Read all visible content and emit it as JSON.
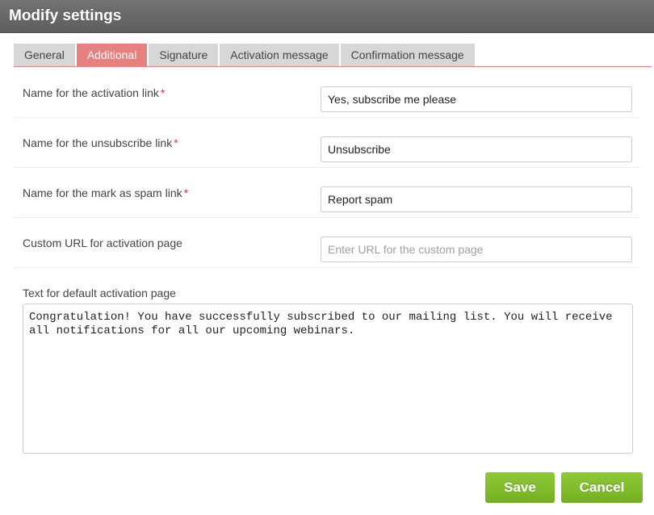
{
  "window": {
    "title": "Modify settings"
  },
  "tabs": [
    {
      "label": "General",
      "active": false
    },
    {
      "label": "Additional",
      "active": true
    },
    {
      "label": "Signature",
      "active": false
    },
    {
      "label": "Activation message",
      "active": false
    },
    {
      "label": "Confirmation message",
      "active": false
    }
  ],
  "form": {
    "activation_link": {
      "label": "Name for the activation link",
      "required_mark": "*",
      "value": "Yes, subscribe me please"
    },
    "unsubscribe_link": {
      "label": "Name for the unsubscribe link",
      "required_mark": "*",
      "value": "Unsubscribe"
    },
    "spam_link": {
      "label": "Name for the mark as spam link",
      "required_mark": "*",
      "value": "Report spam"
    },
    "custom_url": {
      "label": "Custom URL for activation page",
      "value": "",
      "placeholder": "Enter URL for the custom page"
    },
    "activation_text": {
      "label": "Text for default activation page",
      "value": "Congratulation! You have successfully subscribed to our mailing list. You will receive all notifications for all our upcoming webinars."
    }
  },
  "buttons": {
    "save": "Save",
    "cancel": "Cancel"
  },
  "colors": {
    "active_tab": "#e7817f",
    "button_green": "#7fbc2a",
    "titlebar": "#686868",
    "required": "#d23d3d"
  }
}
